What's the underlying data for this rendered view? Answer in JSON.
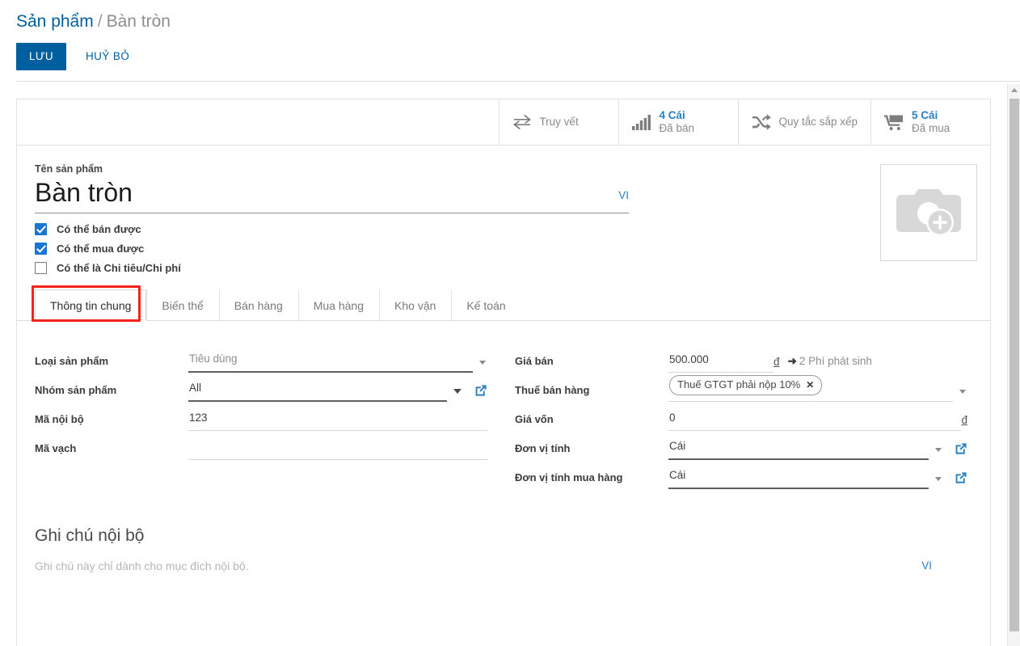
{
  "breadcrumb": {
    "parent": "Sản phẩm",
    "separator": "/",
    "current": "Bàn tròn"
  },
  "toolbar": {
    "save_label": "LƯU",
    "discard_label": "HUỶ BỎ"
  },
  "stats": [
    {
      "icon": "exchange-icon",
      "value": "",
      "label": "Truy vết"
    },
    {
      "icon": "bar-chart-icon",
      "value": "4 Cái",
      "label": "Đã bán"
    },
    {
      "icon": "shuffle-icon",
      "value": "",
      "label": "Quy tắc sắp xếp"
    },
    {
      "icon": "cart-icon",
      "value": "5 Cái",
      "label": "Đã mua"
    }
  ],
  "product": {
    "name_label": "Tên sản phẩm",
    "name_value": "Bàn tròn",
    "lang": "VI",
    "image_placeholder_icon": "camera-add-icon",
    "checkboxes": [
      {
        "label": "Có thể bán được",
        "checked": true
      },
      {
        "label": "Có thể mua được",
        "checked": true
      },
      {
        "label": "Có thể là Chi tiêu/Chi phí",
        "checked": false
      }
    ]
  },
  "tabs": [
    {
      "label": "Thông tin chung",
      "active": true
    },
    {
      "label": "Biến thể",
      "active": false
    },
    {
      "label": "Bán hàng",
      "active": false
    },
    {
      "label": "Mua hàng",
      "active": false
    },
    {
      "label": "Kho vận",
      "active": false
    },
    {
      "label": "Kế toán",
      "active": false
    }
  ],
  "fields_left": {
    "product_type": {
      "label": "Loại sản phẩm",
      "value": "Tiêu dùng"
    },
    "product_group": {
      "label": "Nhóm sản phẩm",
      "value": "All"
    },
    "internal_code": {
      "label": "Mã nội bộ",
      "value": "123"
    },
    "barcode": {
      "label": "Mã vạch",
      "value": ""
    }
  },
  "fields_right": {
    "sale_price": {
      "label": "Giá bán",
      "value": "500.000",
      "currency": "đ",
      "extra_link": "2 Phí phát sinh",
      "arrow": "➜"
    },
    "sale_tax": {
      "label": "Thuế bán hàng",
      "chip": "Thuế GTGT phải nộp 10%",
      "chip_remove": "✕"
    },
    "cost_price": {
      "label": "Giá vốn",
      "value": "0",
      "currency": "đ"
    },
    "uom": {
      "label": "Đơn vị tính",
      "value": "Cái"
    },
    "purchase_uom": {
      "label": "Đơn vị tính mua hàng",
      "value": "Cái"
    }
  },
  "notes": {
    "title": "Ghi chú nội bộ",
    "placeholder": "Ghi chú này chỉ dành cho mục đích nội bộ.",
    "lang": "VI"
  },
  "colors": {
    "accent": "#00609f",
    "link": "#2a7fc0",
    "highlight": "#f4231c",
    "checkbox": "#1a76d2"
  }
}
